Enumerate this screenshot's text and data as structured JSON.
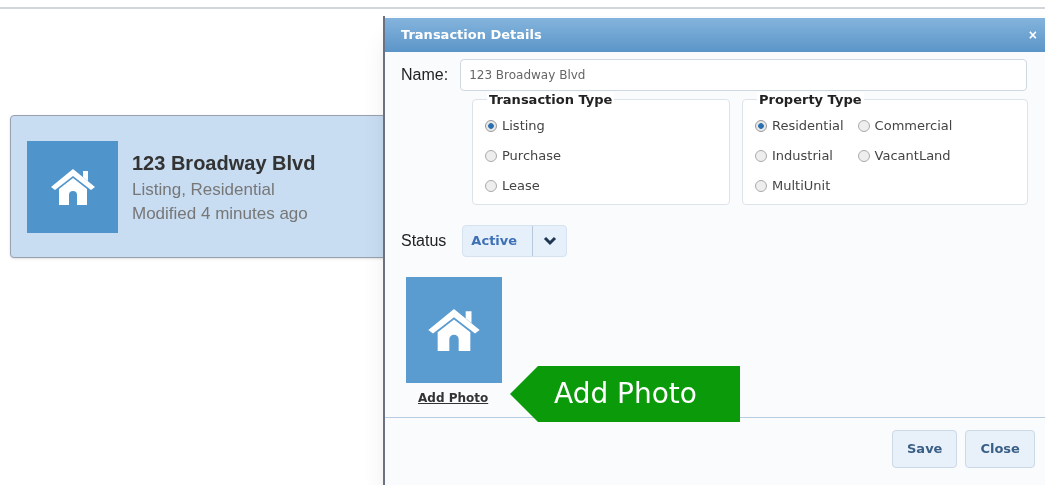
{
  "card": {
    "title": "123 Broadway Blvd",
    "subtitle": "Listing, Residential",
    "modified": "Modified 4 minutes ago"
  },
  "dialog": {
    "title": "Transaction Details",
    "close": "×",
    "name_label": "Name:",
    "name_value": "123 Broadway Blvd",
    "transaction_type": {
      "legend": "Transaction Type",
      "options": [
        {
          "label": "Listing",
          "selected": true
        },
        {
          "label": "Purchase",
          "selected": false
        },
        {
          "label": "Lease",
          "selected": false
        }
      ]
    },
    "property_type": {
      "legend": "Property Type",
      "options": [
        {
          "label": "Residential",
          "selected": true
        },
        {
          "label": "Commercial",
          "selected": false
        },
        {
          "label": "Industrial",
          "selected": false
        },
        {
          "label": "VacantLand",
          "selected": false
        },
        {
          "label": "MultiUnit",
          "selected": false
        }
      ]
    },
    "status_label": "Status",
    "status_value": "Active",
    "photo_link": "Add Photo",
    "buttons": [
      "Save",
      "Close"
    ]
  },
  "callout": {
    "text": "Add Photo"
  }
}
